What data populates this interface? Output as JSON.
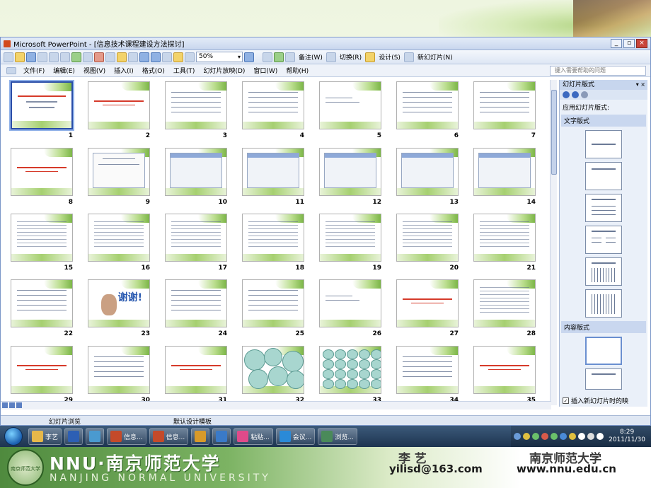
{
  "window": {
    "title": "Microsoft PowerPoint - [信息技术课程建设方法探讨]"
  },
  "toolbar": {
    "zoom": "50%",
    "notes": "备注(W)",
    "transition": "切换(R)",
    "design": "设计(S)",
    "new_slide": "新幻灯片(N)"
  },
  "menu": [
    {
      "label": "文件(F)"
    },
    {
      "label": "编辑(E)"
    },
    {
      "label": "视图(V)"
    },
    {
      "label": "插入(I)"
    },
    {
      "label": "格式(O)"
    },
    {
      "label": "工具(T)"
    },
    {
      "label": "幻灯片放映(D)"
    },
    {
      "label": "窗口(W)"
    },
    {
      "label": "帮助(H)"
    }
  ],
  "help_box": {
    "placeholder": "键入需要帮助的问题"
  },
  "slides": [
    {
      "num": "1",
      "kind": "title"
    },
    {
      "num": "2",
      "kind": "red"
    },
    {
      "num": "3",
      "kind": "text"
    },
    {
      "num": "4",
      "kind": "text"
    },
    {
      "num": "5",
      "kind": "sparse"
    },
    {
      "num": "6",
      "kind": "text"
    },
    {
      "num": "7",
      "kind": "text"
    },
    {
      "num": "8",
      "kind": "red"
    },
    {
      "num": "9",
      "kind": "doc"
    },
    {
      "num": "10",
      "kind": "shot"
    },
    {
      "num": "11",
      "kind": "shot"
    },
    {
      "num": "12",
      "kind": "shot"
    },
    {
      "num": "13",
      "kind": "shot"
    },
    {
      "num": "14",
      "kind": "shot"
    },
    {
      "num": "15",
      "kind": "dense"
    },
    {
      "num": "16",
      "kind": "dense"
    },
    {
      "num": "17",
      "kind": "dense"
    },
    {
      "num": "18",
      "kind": "dense"
    },
    {
      "num": "19",
      "kind": "dense"
    },
    {
      "num": "20",
      "kind": "dense"
    },
    {
      "num": "21",
      "kind": "dense"
    },
    {
      "num": "22",
      "kind": "text"
    },
    {
      "num": "23",
      "kind": "photo"
    },
    {
      "num": "24",
      "kind": "text"
    },
    {
      "num": "25",
      "kind": "text"
    },
    {
      "num": "26",
      "kind": "sparse"
    },
    {
      "num": "27",
      "kind": "red"
    },
    {
      "num": "28",
      "kind": "dense"
    },
    {
      "num": "29",
      "kind": "red"
    },
    {
      "num": "30",
      "kind": "text"
    },
    {
      "num": "31",
      "kind": "red"
    },
    {
      "num": "32",
      "kind": "circles"
    },
    {
      "num": "33",
      "kind": "circles-small"
    },
    {
      "num": "34",
      "kind": "text"
    },
    {
      "num": "35",
      "kind": "red"
    }
  ],
  "slide23_text": "谢谢!",
  "task_pane": {
    "title": "幻灯片版式",
    "apply_label": "应用幻灯片版式:",
    "section1": "文字版式",
    "section2": "内容版式",
    "checkbox_label": "插入新幻灯片时的映"
  },
  "status": {
    "view": "幻灯片浏览",
    "design": "默认设计模板"
  },
  "taskbar": {
    "items": [
      {
        "label": "李艺",
        "color": "#e7b84a"
      },
      {
        "label": "",
        "color": "#2d5fb4"
      },
      {
        "label": "",
        "color": "#4a9ad0"
      },
      {
        "label": "信息...",
        "color": "#c44a2a"
      },
      {
        "label": "信息...",
        "color": "#c44a2a"
      },
      {
        "label": "",
        "color": "#d89a2a"
      },
      {
        "label": "",
        "color": "#3a7ac8"
      },
      {
        "label": "粘贴...",
        "color": "#e04a8a"
      },
      {
        "label": "会议...",
        "color": "#2a8ad8"
      },
      {
        "label": "浏览...",
        "color": "#4a8a5a"
      }
    ],
    "time": "8:29",
    "date": "2011/11/30"
  },
  "footer": {
    "logo_text": "南京师范大学",
    "nnu": "NNU·南京师范大学",
    "nnu_en": "NANJING NORMAL UNIVERSITY",
    "author": "李 艺",
    "email": "yilisd@163.com",
    "university": "南京师范大学",
    "website": "www.nnu.edu.cn"
  }
}
